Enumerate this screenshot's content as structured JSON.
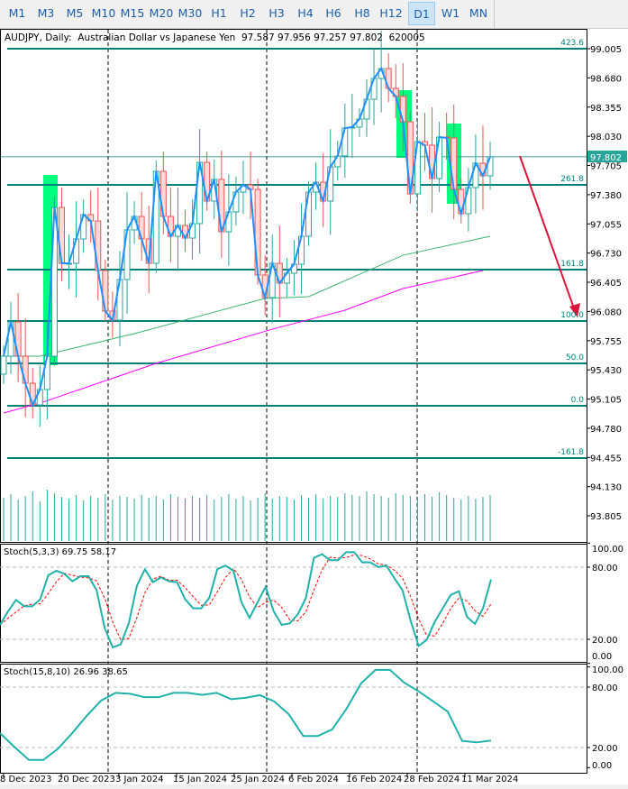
{
  "toolbar": {
    "timeframes": [
      "M1",
      "M3",
      "M5",
      "M10",
      "M15",
      "M20",
      "M30",
      "H1",
      "H2",
      "H3",
      "H4",
      "H6",
      "H8",
      "H12",
      "D1",
      "W1",
      "MN"
    ],
    "active": "D1"
  },
  "chart": {
    "header": "AUDJPY, Daily:  Australian Dollar vs Japanese Yen  97.587 97.956 97.257 97.802  620005",
    "current_price": "97.802",
    "price_axis": [
      "99.005",
      "98.680",
      "98.355",
      "98.030",
      "97.705",
      "97.380",
      "97.055",
      "96.730",
      "96.405",
      "96.080",
      "95.755",
      "95.430",
      "95.105",
      "94.780",
      "94.455",
      "94.130",
      "93.805"
    ],
    "date_axis": [
      "8 Dec 2023",
      "20 Dec 2023",
      "3 Jan 2024",
      "15 Jan 2024",
      "25 Jan 2024",
      "6 Feb 2024",
      "16 Feb 2024",
      "28 Feb 2024",
      "11 Mar 2024"
    ],
    "fib_levels": [
      {
        "label": "423.6",
        "price": 99.005
      },
      {
        "label": "261.8",
        "price": 97.489
      },
      {
        "label": "161.8",
        "price": 96.546
      },
      {
        "label": "100.0",
        "price": 95.974
      },
      {
        "label": "50.0",
        "price": 95.502
      },
      {
        "label": "0.0",
        "price": 95.03
      },
      {
        "label": "-161.8",
        "price": 94.448
      }
    ],
    "colors": {
      "bull": "#26a69a",
      "bear": "#ef5350",
      "bear_fill": "#ffd8d8",
      "fib": "#00807a",
      "zigzag": "#1e90ff",
      "ma_fast": "#3cb371",
      "ma_slow": "#ff00ff",
      "highlight": "#00ff7f",
      "arrow": "#dc143c"
    }
  },
  "chart_data": [
    {
      "type": "candlestick",
      "title": "AUDJPY, Daily",
      "closes": [
        95.582,
        95.964,
        95.582,
        95.281,
        95.04,
        95.211,
        95.582,
        97.238,
        96.616,
        96.616,
        96.887,
        97.158,
        97.088,
        96.536,
        96.084,
        95.984,
        96.435,
        96.988,
        97.138,
        96.887,
        96.616,
        97.64,
        97.138,
        96.917,
        97.038,
        96.897,
        97.058,
        97.74,
        97.309,
        97.55,
        96.967,
        97.188,
        97.409,
        97.489,
        97.439,
        96.486,
        96.235,
        96.616,
        96.395,
        96.506,
        96.606,
        96.917,
        97.409,
        97.519,
        97.309,
        97.69,
        97.811,
        98.122,
        98.132,
        98.222,
        98.443,
        98.674,
        98.784,
        98.563,
        98.473,
        98.192,
        97.389,
        97.971,
        97.931,
        97.56,
        98.021,
        98.011,
        97.439,
        97.168,
        97.459,
        97.73,
        97.59,
        97.802
      ],
      "volumes": [
        48,
        52,
        46,
        50,
        55,
        44,
        57,
        53,
        49,
        47,
        51,
        45,
        50,
        48,
        52,
        46,
        50,
        49,
        47,
        51,
        48,
        50,
        46,
        52,
        49,
        47,
        50,
        48,
        51,
        46,
        49,
        52,
        47,
        50,
        45,
        48,
        53,
        47,
        50,
        49,
        46,
        51,
        48,
        52,
        47,
        50,
        49,
        53,
        51,
        50,
        55,
        52,
        50,
        48,
        53,
        51,
        50,
        47,
        52,
        49,
        54,
        51,
        48,
        46,
        50,
        47,
        49,
        51
      ],
      "ma_fast": [
        [
          0,
          95.582
        ],
        [
          5,
          95.582
        ],
        [
          18,
          95.833
        ],
        [
          36,
          96.225
        ],
        [
          42,
          96.245
        ],
        [
          55,
          96.706
        ],
        [
          67,
          96.917
        ]
      ],
      "ma_slow": [
        [
          0,
          94.95
        ],
        [
          5,
          95.06
        ],
        [
          21,
          95.502
        ],
        [
          37,
          95.883
        ],
        [
          47,
          96.094
        ],
        [
          55,
          96.335
        ],
        [
          66,
          96.536
        ]
      ],
      "ylim": [
        93.6,
        99.25
      ]
    },
    {
      "type": "line",
      "title": "Stoch(5,3,3) 69.75 58.17",
      "levels": [
        "100.00",
        "80.00",
        "20.00",
        "0.00"
      ],
      "main": [
        32,
        43.3,
        52.8,
        47.5,
        47.5,
        53.3,
        73.3,
        77,
        74.5,
        68.3,
        72.5,
        72.5,
        60.8,
        29.5,
        13.3,
        15.8,
        33.3,
        64.5,
        78.3,
        67.5,
        71.5,
        68.3,
        67.5,
        53.3,
        45.8,
        45.8,
        54.5,
        78.3,
        81.3,
        77,
        50.8,
        37.8,
        50.8,
        63.8,
        43.3,
        32,
        33.3,
        40.8,
        54.5,
        87.8,
        90.8,
        85.8,
        85.8,
        92.5,
        92.5,
        84,
        84,
        80,
        81.3,
        70.8,
        60.8,
        35.8,
        14.5,
        19.5,
        34.5,
        45.8,
        57,
        60,
        38.8,
        32.8,
        45.8,
        69.75
      ],
      "ylim": [
        0,
        100
      ]
    },
    {
      "type": "line",
      "title": "Stoch(15,8,10) 26.96 38.65",
      "levels": [
        "100.00",
        "80.00",
        "20.00",
        "0.00"
      ],
      "main": [
        34.3,
        20.6,
        7.7,
        7.7,
        18.6,
        34.3,
        51.4,
        66.6,
        74.3,
        73.4,
        70,
        70,
        74.3,
        74.3,
        72.3,
        74.3,
        68,
        69.4,
        72,
        65.7,
        52.9,
        31.4,
        31.4,
        38,
        58.6,
        83.7,
        97.1,
        97.1,
        84.3,
        75.7,
        65.7,
        55.7,
        26.6,
        25.1,
        26.96
      ],
      "ylim": [
        0,
        100
      ]
    }
  ]
}
